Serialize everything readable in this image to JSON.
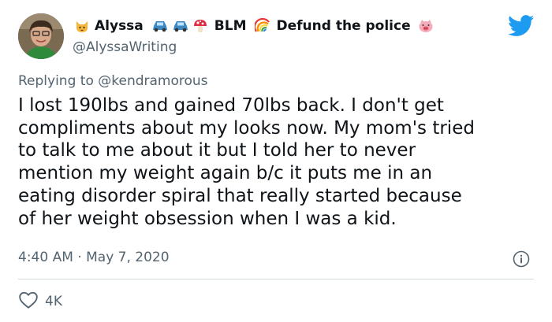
{
  "author": {
    "name": "Alyssa",
    "name_suffix": "BLM",
    "name_tagline": "Defund the police",
    "handle": "@AlyssaWriting"
  },
  "reply": {
    "prefix": "Replying to",
    "mention": "@kendramorous"
  },
  "tweet": {
    "lines": [
      "I lost 190lbs and gained 70lbs back. I don't get",
      "compliments about my looks now. My mom's tried",
      "to talk to me about it but I told her to never",
      "mention my weight again b/c it puts me in an",
      "eating disorder spiral that really started because",
      "of her weight obsession when I was a kid."
    ]
  },
  "meta": {
    "time": "4:40 AM",
    "separator": "·",
    "date": "May 7, 2020"
  },
  "engagement": {
    "likes": "4K"
  },
  "icons": [
    "cat-emoji-icon",
    "car-emoji-icon",
    "car-emoji-icon",
    "mushroom-emoji-icon",
    "rainbow-emoji-icon",
    "pig-emoji-icon",
    "twitter-bird-icon",
    "info-icon",
    "heart-icon"
  ],
  "colors": {
    "twitter_blue": "#1d9bf0",
    "secondary_text": "#536471",
    "divider": "#cfd9de"
  }
}
